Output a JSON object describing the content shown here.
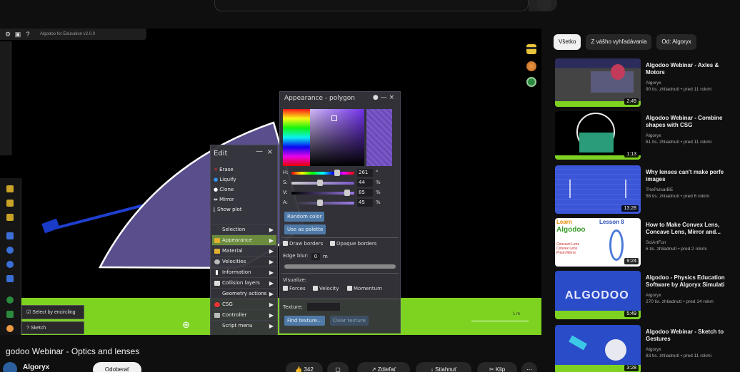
{
  "app": {
    "toolbar_version": "Algodoo for Education v2.0.0",
    "toolbar_icons": [
      "gear-icon",
      "save-icon",
      "help-icon"
    ]
  },
  "edit_menu": {
    "title": "Edit",
    "minimize": "—",
    "close": "×",
    "quick_items": [
      "Erase",
      "Liquify",
      "Clone",
      "Mirror",
      "Show plot"
    ],
    "submenus": [
      "Selection",
      "Appearance",
      "Material",
      "Velocities",
      "Information",
      "Collision layers",
      "Geometry actions",
      "CSG",
      "Controller",
      "Script menu"
    ],
    "active_submenu": "Appearance"
  },
  "appearance_panel": {
    "title": "Appearance - polygon",
    "controls": "● — ×",
    "h_label": "H:",
    "h_value": "261",
    "h_unit": "°",
    "s_label": "S:",
    "s_value": "44",
    "s_unit": "%",
    "v_label": "V:",
    "v_value": "85",
    "v_unit": "%",
    "a_label": "A:",
    "a_value": "45",
    "a_unit": "%",
    "random_color": "Random color",
    "use_as_palette": "Use as palette",
    "draw_borders": "Draw borders",
    "opaque_borders": "Opaque borders",
    "edge_blur_label": "Edge blur:",
    "edge_blur_value": "0",
    "edge_blur_unit": "m",
    "visualize_label": "Visualize:",
    "forces": "Forces",
    "velocity": "Velocity",
    "momentum": "Momentum",
    "texture_label": "Texture:",
    "find_texture": "Find texture...",
    "clear_texture": "Clear texture",
    "color_hex": "#7a58c8"
  },
  "bottom_tools": {
    "select_by_encircling": "Select by encircling",
    "sketch": "Sketch",
    "scale_label": "1 m"
  },
  "video": {
    "title": "godoo Webinar - Optics and lenses",
    "channel": "Algoryx",
    "subscribe": "Odoberať",
    "likes": "342",
    "share": "Zdieľať",
    "download": "Stiahnuť",
    "clip": "Klip"
  },
  "sidebar": {
    "chips": [
      "Všetko",
      "Z vášho vyhľadávania",
      "Od: Algoryx"
    ],
    "active_chip": "Všetko",
    "recommendations": [
      {
        "title": "Algodoo Webinar - Axles &",
        "title2": "Motors",
        "channel": "Algoryx",
        "meta": "90 tis. zhliadnutí • pred 11 rokmi",
        "duration": "2:49"
      },
      {
        "title": "Algodoo Webinar - Combine",
        "title2": "shapes with CSG",
        "channel": "Algoryx",
        "meta": "61 tis. zhliadnutí • pred 11 rokmi",
        "duration": "1:13"
      },
      {
        "title": "Why lenses can't make perfe",
        "title2": "images",
        "channel": "ThePulsarBE",
        "meta": "56 tis. zhliadnutí • pred 6 rokmi",
        "duration": "13:28"
      },
      {
        "title": "How to Make Convex Lens,",
        "title2": "Concave Lens, Mirror and...",
        "channel": "SciArtFun",
        "meta": "6 tis. zhliadnutí • pred 2 rokmi",
        "duration": "9:24"
      },
      {
        "title": "Algodoo - Physics Education",
        "title2": "Software by Algoryx Simulati",
        "channel": "Algoryx",
        "meta": "270 tis. zhliadnutí • pred 14 rokm",
        "duration": "5:49"
      },
      {
        "title": "Algodoo Webinar - Sketch to",
        "title2": "Gestures",
        "channel": "Algoryx",
        "meta": "83 tis. zhliadnutí • pred 11 rokmi",
        "duration": "3:28"
      }
    ],
    "thumb4_text": {
      "learn": "Learn",
      "algodoo": "Algodoo",
      "lesson": "Lesson 8",
      "lines": "Concave Lens Convex Lens Prism Mirror"
    },
    "thumb5_text": "ALGODOO"
  }
}
